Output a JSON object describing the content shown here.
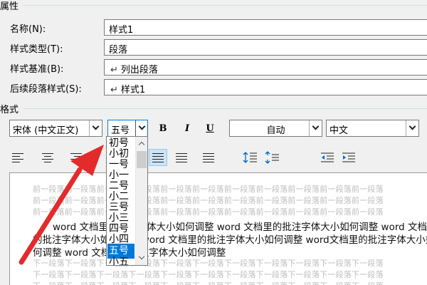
{
  "properties": {
    "section_label": "属性",
    "rows": [
      {
        "label": "名称(N):",
        "value": "样式1",
        "has_return": false
      },
      {
        "label": "样式类型(T):",
        "value": "段落",
        "has_return": false
      },
      {
        "label": "样式基准(B):",
        "value": "列出段落",
        "has_return": true
      },
      {
        "label": "后续段落样式(S):",
        "value": "样式1",
        "has_return": true
      }
    ]
  },
  "format": {
    "section_label": "格式",
    "font_name": "宋体 (中文正文)",
    "font_size": "五号",
    "bold_label": "B",
    "italic_label": "I",
    "underline_label": "U",
    "font_color": "自动",
    "language": "中文"
  },
  "size_dropdown": {
    "items": [
      "初号",
      "小初",
      "一号",
      "小一",
      "二号",
      "小二",
      "三号",
      "小三",
      "四号",
      "小四",
      "五号",
      "小五"
    ],
    "selected": "五号"
  },
  "preview": {
    "prev_paragraph_text": "前一段落前一段落前一段落前一段落前一段落前一段落前一段落前一段落前一段落前一段落前一段落",
    "main_lines": [
      "word 文档里的批注字体大小如何调整 word 文档里的批注字体大小如何调整 word 文档",
      "的批注字体大小如何调整 word 文档里的批注字体大小如何调整 word文档里的批注字体大小如",
      "何调整 word 文档里的批注字体大小如何调整"
    ],
    "next_paragraph_text": "下一段落下一段落下一段落下一段落下一段落下一段落下一段落下一段落下一段落下一段落下一段落"
  },
  "colors": {
    "arrow": "#e32b2b",
    "selection": "#0078d7"
  }
}
